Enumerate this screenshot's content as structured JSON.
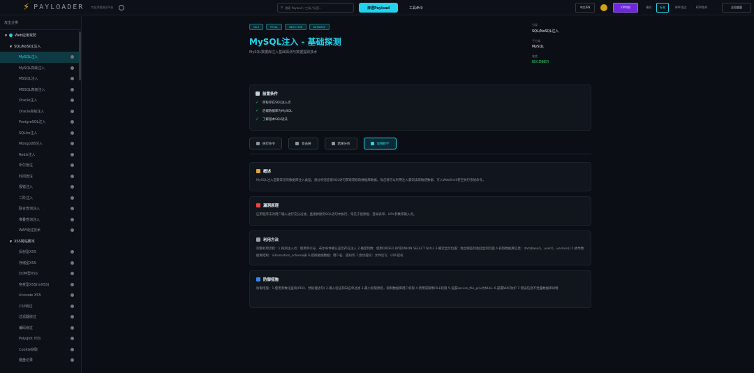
{
  "topbar": {
    "brand": "PAYLOADER",
    "tagline": "专业渗透测试平台",
    "search_placeholder": "搜索 Payload / 工具 / 标签...",
    "primary_button": "渗透Payload",
    "tools_button": "工具命令",
    "lang": "中文/EN",
    "vip": "VIP特权",
    "mode_label": "模式:",
    "mode_standard": "标准",
    "mode_waf": "WAF绕过",
    "mode_edr": "EDR免杀",
    "vars_button": "全局变量"
  },
  "sidebar": {
    "header": "攻击分类",
    "items": [
      {
        "label": "Web应用攻防",
        "level": 0
      },
      {
        "label": "SQL/NoSQL注入",
        "level": 1
      },
      {
        "label": "MySQL注入",
        "level": 2,
        "active": true
      },
      {
        "label": "MySQL高级注入",
        "level": 2
      },
      {
        "label": "MSSQL注入",
        "level": 2
      },
      {
        "label": "MSSQL高级注入",
        "level": 2
      },
      {
        "label": "Oracle注入",
        "level": 2
      },
      {
        "label": "Oracle高级注入",
        "level": 2
      },
      {
        "label": "PostgreSQL注入",
        "level": 2
      },
      {
        "label": "SQLite注入",
        "level": 2
      },
      {
        "label": "MongoDB注入",
        "level": 2
      },
      {
        "label": "Redis注入",
        "level": 2
      },
      {
        "label": "布尔盲注",
        "level": 2
      },
      {
        "label": "时间盲注",
        "level": 2
      },
      {
        "label": "报错注入",
        "level": 2
      },
      {
        "label": "二阶注入",
        "level": 2
      },
      {
        "label": "联合查询注入",
        "level": 2
      },
      {
        "label": "堆叠查询注入",
        "level": 2
      },
      {
        "label": "WAF绕过技术",
        "level": 2
      },
      {
        "label": "XSS跨站脚本",
        "level": 1
      },
      {
        "label": "反射型XSS",
        "level": 2
      },
      {
        "label": "存储型XSS",
        "level": 2
      },
      {
        "label": "DOM型XSS",
        "level": 2
      },
      {
        "label": "突变型XSS(mXSS)",
        "level": 2
      },
      {
        "label": "Unicode XSS",
        "level": 2
      },
      {
        "label": "CSP绕过",
        "level": 2
      },
      {
        "label": "过滤器绕过",
        "level": 2
      },
      {
        "label": "编码绕过",
        "level": 2
      },
      {
        "label": "Polyglot XSS",
        "level": 2
      },
      {
        "label": "Cookie窃取",
        "level": 2
      },
      {
        "label": "键盘记录",
        "level": 2
      }
    ]
  },
  "main": {
    "tags": [
      "SQLI",
      "MYSQL",
      "INJECTION",
      "DATABASE"
    ],
    "title": "MySQL注入 - 基础探测",
    "subtitle": "MySQL数据库注入基础探测与数据提取技术",
    "meta": {
      "category_label": "分类",
      "category_value": "SQL/NoSQL注入",
      "sub_label": "子分类",
      "sub_value": "MySQL",
      "level_label": "难度",
      "level_value": "BEGINNER"
    },
    "prereq": {
      "title": "前置条件",
      "items": [
        "目标存在SQL注入点",
        "后端数据库为MySQL",
        "了解基本SQL语法"
      ]
    },
    "tabs": [
      "执行命令",
      "攻击链",
      "结果分析",
      "详细教学"
    ],
    "sections": [
      {
        "title": "概述",
        "body": "MySQL注入是最常见的数据库注入类型。通过构造恶意SQL语句获取或修改数据库数据。攻击者可以利用注入漏洞读取敏感数据、写入WebShell甚至执行系统命令。"
      },
      {
        "title": "漏洞原理",
        "body": "应用程序未对用户输入进行充分过滤，直接拼接到SQL语句中执行。常见于搜索框、登录表单、URL参数等输入点。"
      },
      {
        "title": "利用方法",
        "body": "完整利用流程：1.探测注入点：使用单引号、布尔条件确认是否存在注入 2.确定列数：使用ORDER BY或UNION SELECT NULL 3.确定显示位置：找出哪些列会回显到页面 4.获取数据库信息：database()、user()、version() 5.枚举数据库结构：information_schema表 6.提取敏感数据：用户名、密码等 7.尝试提权：文件读写、UDF提权"
      },
      {
        "title": "防御措施",
        "body": "防御措施：1.使用参数化查询(PDO、预处理语句) 2.输入验证和白名单过滤 3.最小权限原则，限制数据库用户权限 4.禁用或限制FILE权限 5.设置secure_file_priv为NULL 6.部署WAF防护 7.错误信息不泄露数据库详情"
      }
    ]
  }
}
